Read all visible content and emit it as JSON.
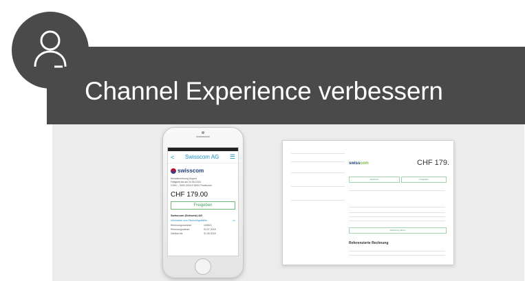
{
  "banner": {
    "title": "Channel Experience verbessern",
    "icon": "user-icon",
    "color": "#4a4a4a"
  },
  "phone": {
    "nav_back": "<",
    "nav_title": "Swisscom AG",
    "logo_text": "swisscom",
    "lines": [
      "Monatsrechnung August",
      "Fälligkeit bis am 24.08.2018",
      "CHSC - 0000 2018 8 0000 Privatkonto"
    ],
    "amount": "CHF 179.00",
    "release_label": "Freigeben",
    "section_title": "Swisscom (Schweiz) AG",
    "info_link": "Information zum Rechnungssteller",
    "rows": [
      {
        "k": "Rechnungsnummer",
        "v": "118813"
      },
      {
        "k": "Rechnungsdatum",
        "v": "02.07.2018"
      },
      {
        "k": "Zahlbar bis",
        "v": "31.08.2018"
      }
    ]
  },
  "document": {
    "logo_a": "swiss",
    "logo_b": "com",
    "amount": "CHF 179.",
    "release_label": "Freigeben",
    "reject_label": "Ablehnen",
    "detail_label": "Rechnung öffnen",
    "section_heading": "Referenzierte Rechnung"
  }
}
